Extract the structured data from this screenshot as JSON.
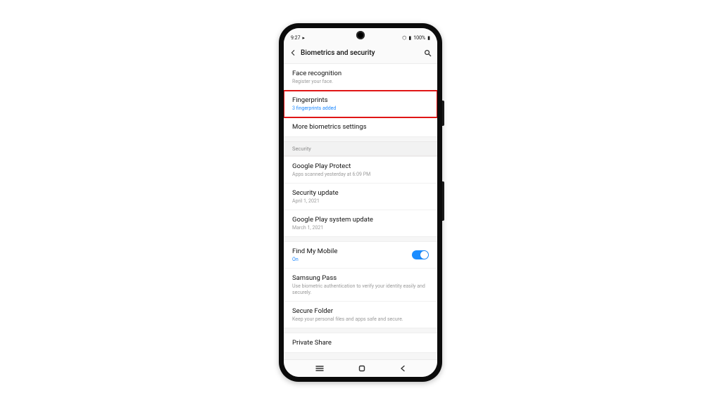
{
  "statusbar": {
    "time": "9:27",
    "camera_indicator": "▸",
    "wifi_glyph": "⬡",
    "signal_glyph": "▮",
    "battery_text": "100%",
    "battery_glyph": "▮"
  },
  "appbar": {
    "title": "Biometrics and security"
  },
  "groups": [
    {
      "items": [
        {
          "label": "Face recognition",
          "sub": "Register your face."
        },
        {
          "label": "Fingerprints",
          "sub": "3 fingerprints added",
          "sub_accent": true,
          "highlighted": true
        },
        {
          "label": "More biometrics settings"
        }
      ]
    }
  ],
  "security_header": "Security",
  "security_items": [
    {
      "label": "Google Play Protect",
      "sub": "Apps scanned yesterday at 6:09 PM"
    },
    {
      "label": "Security update",
      "sub": "April 1, 2021"
    },
    {
      "label": "Google Play system update",
      "sub": "March 1, 2021"
    }
  ],
  "group3_items": [
    {
      "label": "Find My Mobile",
      "sub": "On",
      "sub_accent": true,
      "toggle_on": true
    },
    {
      "label": "Samsung Pass",
      "sub": "Use biometric authentication to verify your identity easily and securely."
    },
    {
      "label": "Secure Folder",
      "sub": "Keep your personal files and apps safe and secure."
    }
  ],
  "group4_items": [
    {
      "label": "Private Share"
    }
  ]
}
